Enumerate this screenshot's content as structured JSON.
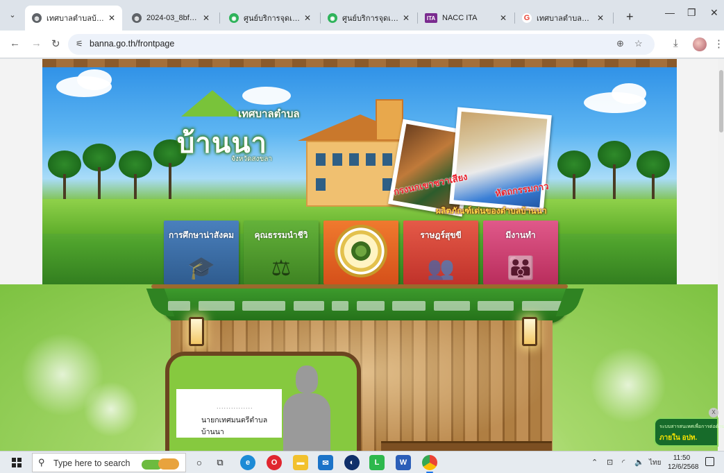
{
  "browser": {
    "tabs": [
      {
        "title": "เทศบาลตำบลบ้านนา (เท",
        "favicon": "globe-icon",
        "active": true
      },
      {
        "title": "2024-03_8bfc54cdd2",
        "favicon": "globe-icon",
        "active": false
      },
      {
        "title": "ศูนย์บริการจุดเดียวเบ็ดเ",
        "favicon": "green-circle-icon",
        "active": false
      },
      {
        "title": "ศูนย์บริการจุดเดียวเบ็ดเ",
        "favicon": "green-circle-icon",
        "active": false
      },
      {
        "title": "NACC ITA",
        "favicon": "ita-icon",
        "active": false
      },
      {
        "title": "เทศบาลตำบลบ้านนา - (",
        "favicon": "google-g-icon",
        "active": false
      }
    ],
    "url": "banna.go.th/frontpage"
  },
  "site": {
    "logo_municipality": "เทศบาลตำบล",
    "logo_name": "บ้านนา",
    "logo_province": "จังหวัดสงขลา",
    "featured_products_title": "ผลิตภัณฑ์เด่นของตำบลบ้านนา",
    "photo_captions": [
      "กรงนกเขาชวาเสียง",
      "หัตถกรรมกาว"
    ],
    "categories": [
      {
        "label": "การศึกษาน่าสังคม",
        "color": "#3f6fa6",
        "icon": "graduation-cap-icon"
      },
      {
        "label": "คุณธรรมนำชีวิ",
        "color": "#4f9a2e",
        "icon": "scales-bird-icon"
      },
      {
        "label": "",
        "color": "#e8601f",
        "icon": "municipal-seal-icon"
      },
      {
        "label": "ราษฎร์สุขขี",
        "color": "#d84336",
        "icon": "people-icon"
      },
      {
        "label": "มีงานทำ",
        "color": "#d2436e",
        "icon": "workers-icon"
      }
    ],
    "nav_items": [
      "",
      "",
      "",
      "",
      "",
      "",
      "",
      "",
      "",
      "",
      "",
      ""
    ],
    "mayor_dots": "...............",
    "mayor_title": "นายกเทศมนตรีตำบลบ้านนา",
    "promo_line1": "ระบบสารสนเทศเพื่อการต่อต้านการทุจริต",
    "promo_line2": "ภายใน อปท."
  },
  "taskbar": {
    "search_placeholder": "Type here to search",
    "lang": "ไทย",
    "time": "11:50",
    "date": "12/6/2568"
  }
}
